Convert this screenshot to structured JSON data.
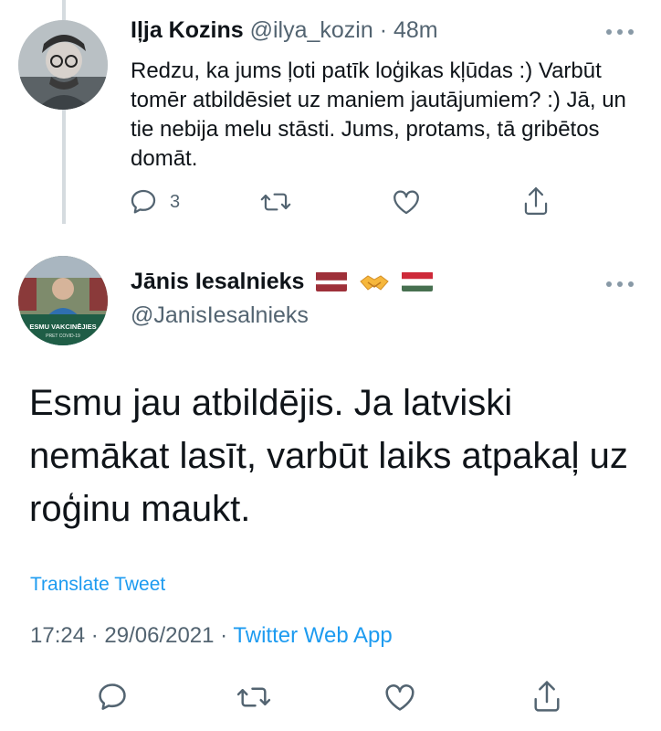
{
  "reply_tweet": {
    "author_name": "Iļja Kozins",
    "author_handle": "@ilya_kozin",
    "separator": "·",
    "time": "48m",
    "text": "Redzu, ka jums ļoti patīk loģikas kļūdas :) Varbūt tomēr atbildēsiet uz maniem jautājumiem? :) Jā, un tie nebija melu stāsti. Jums, protams, tā gribētos domāt.",
    "reply_count": "3"
  },
  "main_tweet": {
    "author_name": "Jānis Iesalnieks",
    "author_handle": "@JanisIesalnieks",
    "name_emoji": [
      "flag-latvia",
      "handshake",
      "flag-hungary"
    ],
    "avatar_caption": "ESMU VAKCINĒJIES PRET COVID-19",
    "text": "Esmu jau atbildējis. Ja latviski nemākat lasīt, varbūt laiks atpakaļ uz roģinu maukt.",
    "translate_label": "Translate Tweet",
    "timestamp": "17:24 · 29/06/2021 · ",
    "source": "Twitter Web App"
  },
  "icons": {
    "reply": "comment-icon",
    "retweet": "retweet-icon",
    "like": "heart-icon",
    "share": "share-icon",
    "more": "more-dots-icon"
  },
  "colors": {
    "accent": "#1d9bf0",
    "muted": "#536471",
    "icon": "#536471",
    "text": "#0f1419"
  }
}
